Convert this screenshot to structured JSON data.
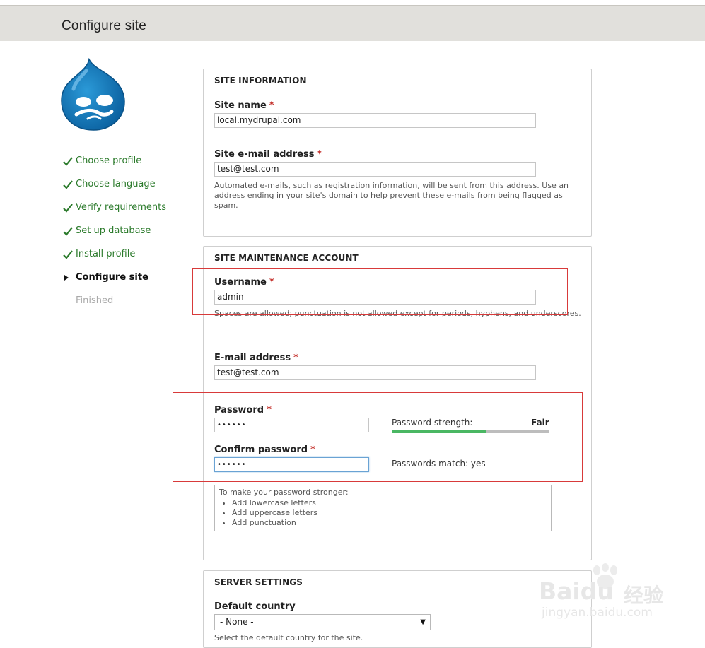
{
  "header": {
    "title": "Configure site"
  },
  "steps": [
    {
      "label": "Choose profile",
      "state": "done"
    },
    {
      "label": "Choose language",
      "state": "done"
    },
    {
      "label": "Verify requirements",
      "state": "done"
    },
    {
      "label": "Set up database",
      "state": "done"
    },
    {
      "label": "Install profile",
      "state": "done"
    },
    {
      "label": "Configure site",
      "state": "active"
    },
    {
      "label": "Finished",
      "state": "todo"
    }
  ],
  "required_mark": "*",
  "site_information": {
    "legend": "SITE INFORMATION",
    "site_name_label": "Site name",
    "site_name_value": "local.mydrupal.com",
    "site_email_label": "Site e-mail address",
    "site_email_value": "test@test.com",
    "site_email_help": "Automated e-mails, such as registration information, will be sent from this address. Use an address ending in your site's domain to help prevent these e-mails from being flagged as spam."
  },
  "maintenance_account": {
    "legend": "SITE MAINTENANCE ACCOUNT",
    "username_label": "Username",
    "username_value": "admin",
    "username_help": "Spaces are allowed; punctuation is not allowed except for periods, hyphens, and underscores.",
    "email_label": "E-mail address",
    "email_value": "test@test.com",
    "password_label": "Password",
    "password_value": "••••••",
    "confirm_label": "Confirm password",
    "confirm_value": "••••••",
    "strength_label": "Password strength:",
    "strength_value": "Fair",
    "strength_fraction": 0.6,
    "match_text": "Passwords match: yes",
    "tips_heading": "To make your password stronger:",
    "tips": [
      "Add lowercase letters",
      "Add uppercase letters",
      "Add punctuation"
    ]
  },
  "server_settings": {
    "legend": "SERVER SETTINGS",
    "country_label": "Default country",
    "country_value": "- None -",
    "country_help": "Select the default country for the site."
  },
  "watermark": {
    "brand": "Baidu",
    "cn": "经验",
    "url": "jingyan.baidu.com"
  },
  "colors": {
    "header_bg": "#e1e0dc",
    "done_step": "#2b7a2b",
    "required": "#c4302b",
    "strength_bar": "#4ab763",
    "annotation_box": "#d83a3a",
    "drupal_blue": "#0b75bb"
  }
}
